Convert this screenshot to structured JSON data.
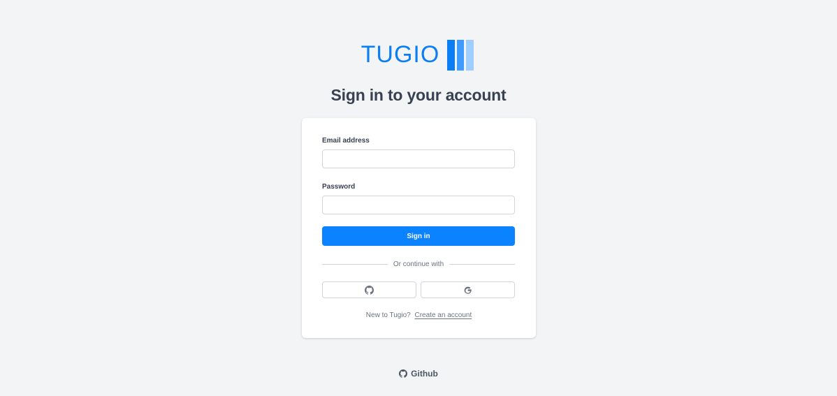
{
  "brand": {
    "name": "TUGIO",
    "accent": "#0b7ef5",
    "mark_colors": [
      "#0b7ef5",
      "#3f9bff",
      "#9fcdff"
    ]
  },
  "page": {
    "title": "Sign in to your account"
  },
  "form": {
    "email_label": "Email address",
    "email_value": "",
    "password_label": "Password",
    "password_value": "",
    "signin_label": "Sign in",
    "signin_color": "#0b82ff"
  },
  "social": {
    "divider_text": "Or continue with",
    "buttons": [
      {
        "icon": "github-icon"
      },
      {
        "icon": "google-icon"
      }
    ]
  },
  "signup": {
    "prompt": "New to Tugio?",
    "link_label": "Create an account"
  },
  "footer": {
    "github_label": "Github",
    "github_icon": "github-icon"
  }
}
